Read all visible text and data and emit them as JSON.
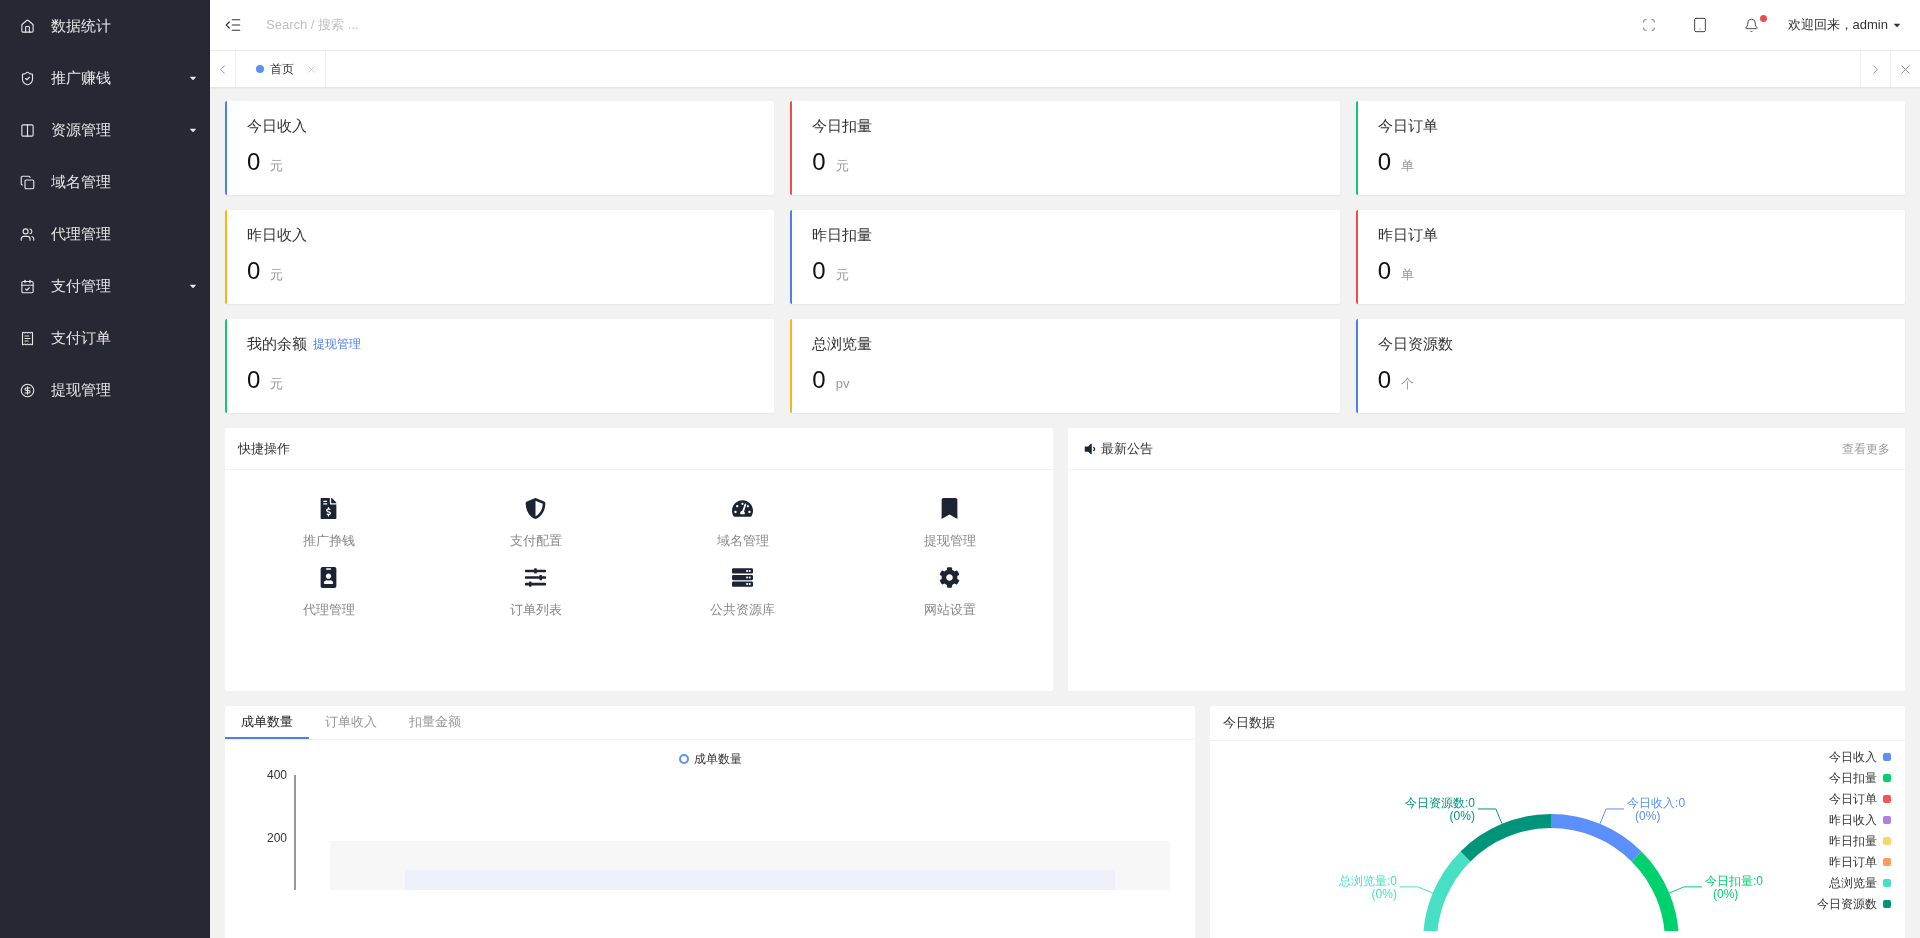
{
  "sidebar": {
    "items": [
      {
        "label": "数据统计",
        "expandable": false
      },
      {
        "label": "推广赚钱",
        "expandable": true
      },
      {
        "label": "资源管理",
        "expandable": true
      },
      {
        "label": "域名管理",
        "expandable": false
      },
      {
        "label": "代理管理",
        "expandable": false
      },
      {
        "label": "支付管理",
        "expandable": true
      },
      {
        "label": "支付订单",
        "expandable": false
      },
      {
        "label": "提现管理",
        "expandable": false
      }
    ]
  },
  "topbar": {
    "search": {
      "placeholder": "Search / 搜索 ..."
    },
    "notifications": {
      "unread": true
    },
    "user": "欢迎回来，admin"
  },
  "page_tabs": [
    {
      "label": "首页",
      "selected": true
    }
  ],
  "stats": [
    {
      "label": "今日收入",
      "value": "0",
      "unit": "元",
      "color": "#4e7ef0"
    },
    {
      "label": "今日扣量",
      "value": "0",
      "unit": "元",
      "color": "#ee4d4d"
    },
    {
      "label": "今日订单",
      "value": "0",
      "unit": "单",
      "color": "#12c86f"
    },
    {
      "label": "昨日收入",
      "value": "0",
      "unit": "元",
      "color": "#f9b51c"
    },
    {
      "label": "昨日扣量",
      "value": "0",
      "unit": "元",
      "color": "#4e7ef0"
    },
    {
      "label": "昨日订单",
      "value": "0",
      "unit": "单",
      "color": "#ee4d4d"
    },
    {
      "label": "我的余额",
      "link": "提现管理",
      "value": "0",
      "unit": "元",
      "color": "#12c86f"
    },
    {
      "label": "总浏览量",
      "value": "0",
      "unit": "pv",
      "color": "#f9b51c"
    },
    {
      "label": "今日资源数",
      "value": "0",
      "unit": "个",
      "color": "#4e7ef0"
    }
  ],
  "quick_actions": {
    "title": "快捷操作",
    "items": [
      "推广挣钱",
      "支付配置",
      "域名管理",
      "提现管理",
      "代理管理",
      "订单列表",
      "公共资源库",
      "网站设置"
    ]
  },
  "announcements": {
    "title": "最新公告",
    "more": "查看更多"
  },
  "trend": {
    "tabs": [
      {
        "label": "成单数量",
        "selected": true
      },
      {
        "label": "订单收入",
        "selected": false
      },
      {
        "label": "扣量金额",
        "selected": false
      }
    ],
    "legend": {
      "label": "成单数量",
      "color": "#5b8ff9"
    },
    "y_axis_labels": [
      "400",
      "200"
    ]
  },
  "today": {
    "title": "今日数据",
    "legend": [
      {
        "label": "今日收入",
        "color": "#5b8ff9",
        "callout": {
          "text": "今日收入:0",
          "percent": "(0%)"
        }
      },
      {
        "label": "今日扣量",
        "color": "#00d16f",
        "callout": {
          "text": "今日扣量:0",
          "percent": "(0%)"
        }
      },
      {
        "label": "今日订单",
        "color": "#f25656"
      },
      {
        "label": "昨日收入",
        "color": "#b07fdc"
      },
      {
        "label": "昨日扣量",
        "color": "#fcd56c"
      },
      {
        "label": "昨日订单",
        "color": "#ff9a5a"
      },
      {
        "label": "总浏览量",
        "color": "#47e0c4",
        "callout": {
          "text": "总浏览量:0",
          "percent": "(0%)"
        }
      },
      {
        "label": "今日资源数",
        "color": "#00957a",
        "callout": {
          "text": "今日资源数:0",
          "percent": "(0%)"
        }
      }
    ]
  }
}
